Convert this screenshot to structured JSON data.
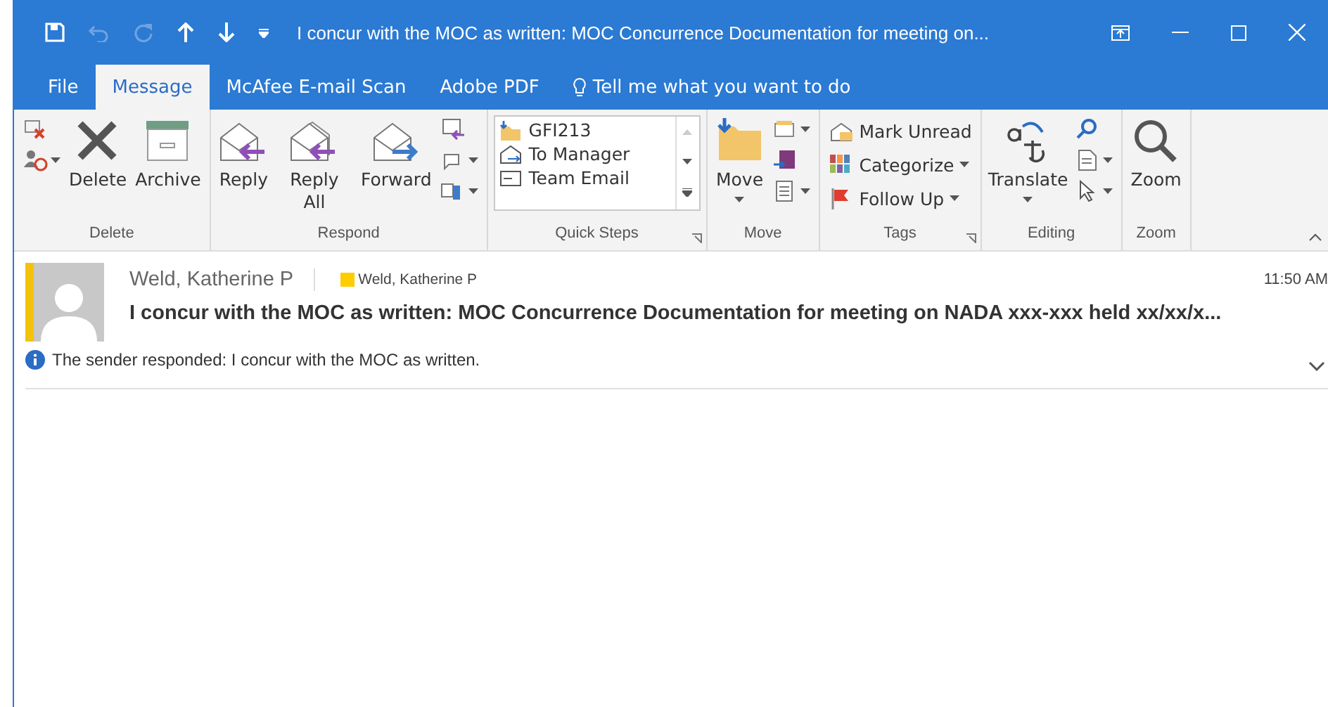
{
  "window": {
    "title": "I concur with the MOC as written: MOC Concurrence Documentation for meeting on...",
    "quick_access": [
      {
        "kind": "save",
        "disabled": false
      },
      {
        "kind": "undo",
        "disabled": true
      },
      {
        "kind": "redo",
        "disabled": true
      },
      {
        "kind": "up",
        "disabled": false
      },
      {
        "kind": "down",
        "disabled": false
      },
      {
        "kind": "customize",
        "disabled": false
      }
    ]
  },
  "tabs": [
    {
      "label": "File",
      "selected": false
    },
    {
      "label": "Message",
      "selected": true
    },
    {
      "label": "McAfee E-mail Scan",
      "selected": false
    },
    {
      "label": "Adobe PDF",
      "selected": false
    }
  ],
  "tell_me": {
    "placeholder": "Tell me what you want to do"
  },
  "ribbon": {
    "groups": [
      {
        "label": "Delete",
        "launcher": false,
        "large": [
          {
            "label": "Delete",
            "dropdown": false
          },
          {
            "label": "Archive",
            "dropdown": false
          }
        ]
      },
      {
        "label": "Respond",
        "launcher": false,
        "large": [
          {
            "label": "Reply",
            "dropdown": false
          },
          {
            "label": "Reply All",
            "dropdown": false
          },
          {
            "label": "Forward",
            "dropdown": false
          }
        ]
      },
      {
        "label": "Quick Steps",
        "launcher": true,
        "gallery": [
          {
            "label": "GFI213"
          },
          {
            "label": "To Manager"
          },
          {
            "label": "Team Email"
          }
        ]
      },
      {
        "label": "Move",
        "launcher": false,
        "large": [
          {
            "label": "Move",
            "dropdown": true
          }
        ]
      },
      {
        "label": "Tags",
        "launcher": true,
        "small": [
          {
            "label": "Mark Unread",
            "dropdown": false
          },
          {
            "label": "Categorize",
            "dropdown": true
          },
          {
            "label": "Follow Up",
            "dropdown": true
          }
        ]
      },
      {
        "label": "Editing",
        "launcher": false,
        "large": [
          {
            "label": "Translate",
            "dropdown": true
          }
        ]
      },
      {
        "label": "Zoom",
        "launcher": false,
        "large": [
          {
            "label": "Zoom",
            "dropdown": false
          }
        ]
      }
    ]
  },
  "message": {
    "sender": "Weld, Katherine P",
    "category": {
      "label": "Weld, Katherine P",
      "color": "#ffcc00"
    },
    "time": "11:50 AM",
    "subject": "I concur with the MOC as written: MOC Concurrence Documentation for meeting on NADA xxx-xxx held xx/xx/x...",
    "info": "The sender responded: I concur with the MOC as written."
  }
}
